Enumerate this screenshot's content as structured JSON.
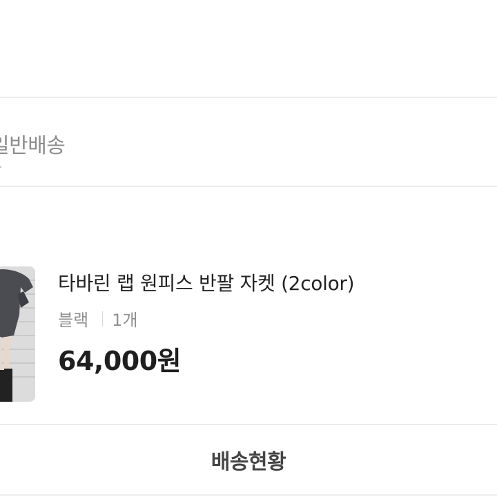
{
  "shipping": {
    "method": "일반배송"
  },
  "order_item": {
    "name": "타바린 랩 원피스 반팔 자켓 (2color)",
    "option_color": "블랙",
    "quantity": "1개",
    "price": "64,000원"
  },
  "actions": {
    "track_label": "배송현황"
  },
  "colors": {
    "divider": "#ececec",
    "muted_text": "#8f8f8f",
    "primary_text": "#222222"
  }
}
